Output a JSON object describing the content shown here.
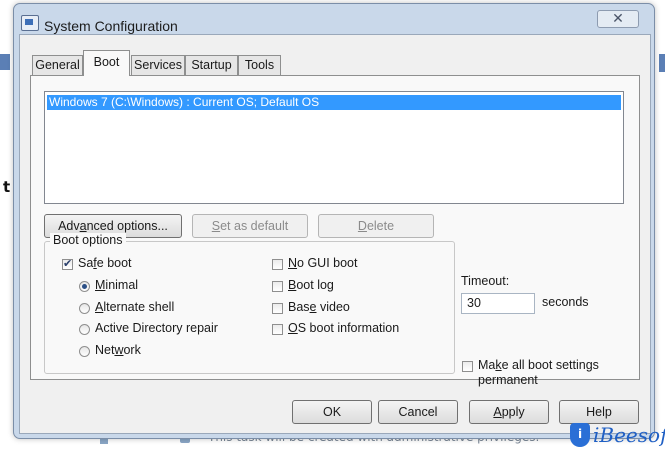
{
  "window": {
    "title": "System Configuration",
    "close_glyph": "✕"
  },
  "tabs": [
    {
      "label": "General",
      "active": false
    },
    {
      "label": "Boot",
      "active": true
    },
    {
      "label": "Services",
      "active": false
    },
    {
      "label": "Startup",
      "active": false
    },
    {
      "label": "Tools",
      "active": false
    }
  ],
  "boot_list": {
    "entries": [
      "Windows 7 (C:\\Windows) : Current OS; Default OS"
    ],
    "selected_index": 0
  },
  "boot_buttons": {
    "advanced_prefix": "Adv",
    "advanced_underline": "a",
    "advanced_suffix": "nced options...",
    "set_default_prefix": "",
    "set_default_underline": "S",
    "set_default_suffix": "et as default",
    "delete_prefix": "",
    "delete_underline": "D",
    "delete_suffix": "elete"
  },
  "boot_options": {
    "group_label": "Boot options",
    "safe_boot": {
      "prefix": "Sa",
      "underline": "f",
      "suffix": "e boot",
      "checked": true
    },
    "radios": [
      {
        "prefix": "",
        "underline": "M",
        "suffix": "inimal",
        "checked": true
      },
      {
        "prefix": "",
        "underline": "A",
        "suffix": "lternate shell",
        "checked": false
      },
      {
        "prefix": "Active Directory repair",
        "underline": "",
        "suffix": "",
        "checked": false
      },
      {
        "prefix": "Net",
        "underline": "w",
        "suffix": "ork",
        "checked": false
      }
    ],
    "right_checks": [
      {
        "prefix": "",
        "underline": "N",
        "suffix": "o GUI boot",
        "checked": false
      },
      {
        "prefix": "",
        "underline": "B",
        "suffix": "oot log",
        "checked": false
      },
      {
        "prefix": "Bas",
        "underline": "e",
        "suffix": " video",
        "checked": false
      },
      {
        "prefix": "",
        "underline": "O",
        "suffix": "S boot information",
        "checked": false
      }
    ]
  },
  "timeout": {
    "label": "Timeout:",
    "value": "30",
    "unit": "seconds"
  },
  "permanent": {
    "line1_prefix": "Ma",
    "line1_underline": "k",
    "line1_suffix": "e all boot settings",
    "line2": "permanent",
    "checked": false
  },
  "dialog_buttons": {
    "ok": "OK",
    "cancel": "Cancel",
    "apply_underline": "A",
    "apply_suffix": "pply",
    "help": "Help"
  },
  "background": {
    "bold_char": "t",
    "bottom_text": "This task will be created with administrative privileges."
  },
  "watermark": {
    "logo_letter": "i",
    "text": "iBeesoft"
  }
}
